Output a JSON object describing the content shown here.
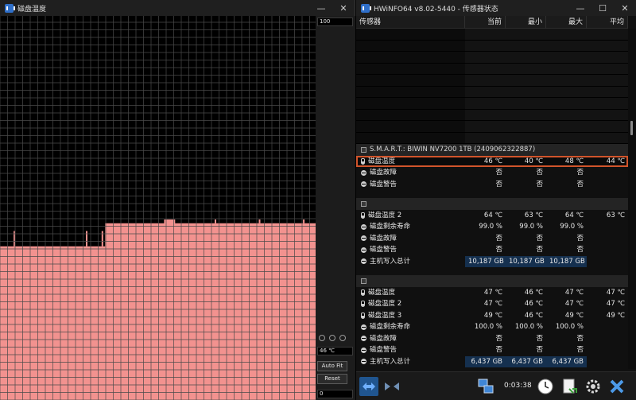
{
  "graph_window": {
    "title": "磁盘温度",
    "buttons": {
      "minimize": "—",
      "close": "✕"
    },
    "scale_max": "100",
    "current_value": "46 ℃",
    "scale_min": "0",
    "auto_fit_label": "Auto Fit",
    "reset_label": "Reset",
    "colors": {
      "grid": "#4a4a4a",
      "fill": "#f2928f",
      "background": "#000000"
    }
  },
  "chart_data": {
    "type": "area",
    "title": "磁盘温度",
    "ylim": [
      0,
      100
    ],
    "values": [
      36,
      36,
      36,
      36,
      36,
      36,
      36,
      36,
      36,
      36,
      36,
      36,
      36,
      36,
      36,
      36,
      36,
      36,
      36,
      36,
      36,
      36,
      36,
      36,
      36,
      36,
      36,
      36,
      36,
      36,
      36,
      36,
      36,
      36,
      36,
      36,
      36,
      36,
      36,
      36,
      36,
      36,
      36,
      36,
      36,
      36,
      36,
      36,
      36,
      36,
      36,
      36,
      36,
      36,
      36,
      36,
      36,
      36,
      36,
      36,
      36,
      36,
      36,
      36,
      36,
      36,
      36,
      36,
      36,
      36,
      36,
      36,
      36,
      36,
      36,
      36,
      36,
      36,
      36,
      36,
      36,
      36,
      36,
      36,
      36,
      36,
      36,
      36,
      36,
      36,
      36,
      36,
      36,
      36,
      36,
      36,
      36,
      36,
      36,
      36,
      36,
      36,
      36,
      36,
      36,
      36,
      36,
      36,
      36,
      36,
      36,
      36,
      36,
      36,
      36,
      36,
      36,
      36,
      36,
      36,
      36,
      36,
      36,
      36,
      36,
      36,
      36,
      36,
      36,
      36,
      36,
      36,
      36,
      36,
      36,
      36,
      36,
      36,
      36,
      36,
      36,
      36,
      36,
      36,
      36,
      36,
      36,
      36,
      36,
      36,
      36,
      36,
      36,
      36,
      36,
      36,
      36,
      36,
      36,
      36,
      36,
      36,
      36,
      36,
      36,
      36,
      36,
      36,
      36,
      36,
      36,
      36,
      36,
      36,
      36,
      36,
      36,
      36,
      36,
      36,
      36,
      36,
      36,
      36,
      36,
      36,
      36,
      36,
      36,
      36,
      36,
      36,
      36,
      36,
      36,
      36,
      36,
      36,
      36,
      36,
      36,
      36,
      36,
      36,
      36,
      36,
      36,
      36,
      36,
      36,
      36,
      36,
      36,
      36,
      36,
      36,
      36,
      36,
      36,
      36,
      36,
      36,
      36,
      36,
      36,
      36,
      36,
      36,
      36,
      36,
      36,
      36,
      36,
      36,
      36,
      36,
      36,
      36,
      36,
      36,
      36,
      36,
      36,
      36,
      36,
      36,
      36,
      36,
      36,
      36,
      36,
      36,
      36,
      36,
      36,
      36,
      36,
      36,
      36,
      36,
      36,
      36,
      36,
      36,
      36,
      36,
      36,
      36,
      36,
      36,
      36,
      36,
      36,
      36,
      36,
      36,
      36,
      36,
      36,
      36,
      36,
      36,
      36,
      36,
      36,
      36,
      36,
      36,
      36,
      36,
      36,
      36,
      36,
      36,
      36,
      36,
      36,
      36,
      36,
      36,
      36,
      36,
      36,
      36,
      36,
      36,
      36,
      36,
      36,
      36,
      36,
      36,
      36,
      36,
      36,
      36,
      36,
      36,
      36,
      36,
      36,
      36,
      36,
      36,
      36,
      36,
      36,
      36,
      36,
      36,
      36,
      36,
      36,
      36,
      36,
      36,
      36,
      36,
      36,
      36,
      36,
      36,
      36,
      36,
      36,
      36,
      36,
      36,
      36,
      36,
      36,
      36,
      36,
      36,
      36,
      36,
      36,
      36,
      36,
      36,
      36,
      36,
      36,
      36,
      36,
      36,
      36,
      36,
      36,
      36,
      36,
      36,
      36,
      36,
      36,
      36,
      36,
      36,
      36,
      36,
      36,
      36,
      36,
      36,
      36,
      36,
      36,
      36,
      36,
      36,
      36,
      36,
      36,
      36,
      36,
      36,
      36,
      36,
      36,
      36,
      36,
      36,
      36,
      36,
      36,
      36,
      36,
      36,
      36,
      36,
      36,
      36,
      36,
      36,
      36,
      36,
      36,
      36,
      36,
      36,
      36,
      36,
      36,
      36,
      36,
      36,
      36,
      36,
      36,
      36,
      36
    ],
    "series": [
      {
        "values": [
          40,
          40,
          40,
          40,
          40,
          40,
          40,
          40,
          40,
          40,
          40,
          40,
          40,
          40,
          40,
          40,
          40,
          40,
          40,
          40,
          40,
          40,
          40,
          40,
          40,
          40,
          40,
          40,
          40,
          40,
          40,
          40,
          40,
          40,
          40,
          40,
          40,
          40,
          40,
          40,
          40,
          40,
          40,
          40,
          40,
          40,
          40,
          40,
          40,
          40,
          40,
          40,
          40,
          40,
          40,
          40,
          40,
          40,
          40,
          40,
          40,
          40,
          40,
          40,
          40,
          40,
          40,
          40,
          40,
          40,
          40,
          40,
          40,
          40,
          40,
          40,
          40,
          40,
          40,
          40,
          40,
          40,
          40,
          40,
          40,
          40,
          40,
          40,
          40,
          40,
          40,
          40,
          40,
          40,
          40,
          40,
          40,
          40,
          40,
          40,
          40,
          40,
          40,
          40,
          40,
          40,
          40,
          40,
          40,
          40,
          40,
          40,
          40,
          40,
          40,
          40,
          40,
          40,
          40,
          40,
          40,
          40,
          40,
          40,
          40,
          40,
          40,
          40,
          40,
          40,
          40,
          40,
          40,
          40,
          40,
          40,
          40,
          40,
          40,
          40,
          40,
          40,
          40,
          40,
          40,
          40,
          40,
          40,
          40,
          40,
          40,
          40,
          40,
          40,
          40,
          40,
          40,
          40,
          40,
          40,
          40,
          40,
          40,
          40,
          40,
          40,
          40,
          40,
          40,
          40,
          40,
          40,
          40,
          40,
          40,
          40,
          40,
          40,
          40,
          40,
          40,
          40,
          40,
          40,
          40,
          40,
          40,
          40,
          40,
          40,
          40,
          40,
          40,
          40,
          40,
          40,
          40,
          40,
          40,
          40,
          40,
          40,
          40,
          40,
          40,
          40,
          40,
          40,
          40,
          40,
          40,
          40,
          40,
          40,
          40,
          40,
          40,
          40,
          40,
          40,
          40,
          40,
          40,
          40,
          40,
          40,
          40,
          40,
          40,
          40,
          40,
          40,
          40,
          40,
          40,
          40,
          40,
          40,
          40,
          40,
          40,
          40,
          40,
          40,
          40,
          40,
          40,
          40,
          40,
          40,
          40,
          40,
          40,
          40,
          40,
          40,
          40,
          40,
          40,
          40,
          40,
          40,
          40,
          40,
          40,
          40,
          40,
          40,
          40,
          40,
          40,
          40,
          40,
          40,
          40,
          40,
          40,
          40,
          40,
          40,
          40,
          40,
          40,
          40,
          40,
          40,
          40,
          40,
          40,
          40,
          40,
          40,
          40,
          40,
          40,
          40,
          40,
          40,
          40,
          40,
          40,
          40,
          40,
          40,
          40,
          40,
          40,
          40,
          40,
          40,
          40,
          40,
          40,
          40,
          40,
          40,
          40,
          40,
          40,
          40,
          40,
          40,
          40,
          40,
          40,
          40,
          40,
          40,
          40,
          40,
          40,
          40,
          40,
          40,
          40,
          40,
          40,
          40,
          40,
          40,
          40,
          40,
          40,
          40,
          40,
          40,
          40,
          40,
          40,
          40,
          40,
          40,
          40,
          40,
          40,
          40,
          40,
          40,
          40,
          40,
          40,
          40,
          40,
          40,
          40,
          40,
          40,
          40,
          40,
          40,
          40,
          40,
          40,
          40,
          40,
          40,
          40,
          40,
          40,
          40,
          40,
          40,
          40,
          40,
          40,
          40,
          40,
          40,
          40,
          40,
          40,
          40,
          40,
          40,
          40,
          40,
          40,
          40,
          40,
          40,
          40,
          40,
          40,
          40,
          40,
          40,
          40,
          40,
          40,
          40,
          40,
          40,
          40,
          40,
          40,
          40,
          40,
          40
        ]
      }
    ],
    "steps": [
      {
        "start": 0,
        "end": 0.333,
        "value": 40
      },
      {
        "start": 0.333,
        "end": 0.52,
        "value": 46
      },
      {
        "start": 0.52,
        "end": 0.555,
        "value": 47
      },
      {
        "start": 0.555,
        "end": 1.0,
        "value": 46
      }
    ],
    "spikes": [
      {
        "at": 0.043,
        "value": 44
      },
      {
        "at": 0.272,
        "value": 44
      },
      {
        "at": 0.322,
        "value": 44
      },
      {
        "at": 0.68,
        "value": 47
      },
      {
        "at": 0.82,
        "value": 47
      },
      {
        "at": 0.96,
        "value": 47
      }
    ],
    "grid": true
  },
  "sensor_window": {
    "title": "HWiNFO64 v8.02-5440 - 传感器状态",
    "buttons": {
      "minimize": "—",
      "maximize": "☐",
      "close": "✕"
    },
    "columns": [
      "传感器",
      "当前",
      "最小",
      "最大",
      "平均"
    ],
    "groups": [
      {
        "header": "S.M.A.R.T.: BIWIN NV7200 1TB (2409062322887)",
        "rows": [
          {
            "icon": "thermometer-icon",
            "label": "磁盘温度",
            "cur": "46 ℃",
            "min": "40 ℃",
            "max": "48 ℃",
            "avg": "44 ℃",
            "selected": true
          },
          {
            "icon": "status-icon",
            "label": "磁盘故障",
            "cur": "否",
            "min": "否",
            "max": "否",
            "avg": ""
          },
          {
            "icon": "status-icon",
            "label": "磁盘警告",
            "cur": "否",
            "min": "否",
            "max": "否",
            "avg": ""
          }
        ]
      },
      {
        "header": "",
        "rows": [
          {
            "icon": "thermometer-icon",
            "label": "磁盘温度 2",
            "cur": "64 ℃",
            "min": "63 ℃",
            "max": "64 ℃",
            "avg": "63 ℃"
          },
          {
            "icon": "status-icon",
            "label": "磁盘剩余寿命",
            "cur": "99.0 %",
            "min": "99.0 %",
            "max": "99.0 %",
            "avg": ""
          },
          {
            "icon": "status-icon",
            "label": "磁盘故障",
            "cur": "否",
            "min": "否",
            "max": "否",
            "avg": ""
          },
          {
            "icon": "status-icon",
            "label": "磁盘警告",
            "cur": "否",
            "min": "否",
            "max": "否",
            "avg": ""
          },
          {
            "icon": "sum-icon",
            "label": "主机写入总计",
            "cur": "10,187 GB",
            "min": "10,187 GB",
            "max": "10,187 GB",
            "avg": "",
            "highlight": true
          }
        ]
      },
      {
        "header": "",
        "rows": [
          {
            "icon": "thermometer-icon",
            "label": "磁盘温度",
            "cur": "47 ℃",
            "min": "46 ℃",
            "max": "47 ℃",
            "avg": "47 ℃"
          },
          {
            "icon": "thermometer-icon",
            "label": "磁盘温度 2",
            "cur": "47 ℃",
            "min": "46 ℃",
            "max": "47 ℃",
            "avg": "47 ℃"
          },
          {
            "icon": "thermometer-icon",
            "label": "磁盘温度 3",
            "cur": "49 ℃",
            "min": "46 ℃",
            "max": "49 ℃",
            "avg": "49 ℃"
          },
          {
            "icon": "status-icon",
            "label": "磁盘剩余寿命",
            "cur": "100.0 %",
            "min": "100.0 %",
            "max": "100.0 %",
            "avg": ""
          },
          {
            "icon": "status-icon",
            "label": "磁盘故障",
            "cur": "否",
            "min": "否",
            "max": "否",
            "avg": ""
          },
          {
            "icon": "status-icon",
            "label": "磁盘警告",
            "cur": "否",
            "min": "否",
            "max": "否",
            "avg": ""
          },
          {
            "icon": "sum-icon",
            "label": "主机写入总计",
            "cur": "6,437 GB",
            "min": "6,437 GB",
            "max": "6,437 GB",
            "avg": "",
            "highlight": true
          }
        ]
      }
    ],
    "toolbar": {
      "timer": "0:03:38",
      "icons": [
        "arrows-left-right-icon",
        "arrows-collapse-icon",
        "network-icon",
        "clock-icon",
        "report-icon",
        "settings-icon",
        "close-app-icon"
      ]
    }
  }
}
